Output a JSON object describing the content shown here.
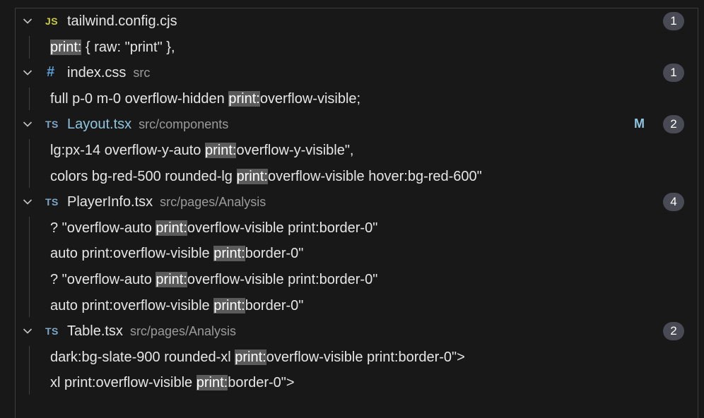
{
  "files": [
    {
      "name": "tailwind.config.cjs",
      "path": "",
      "icon": "js-file-icon",
      "icon_text": "JS",
      "count": "1",
      "modified": "",
      "matches": [
        {
          "before": "",
          "hit": "print:",
          "after": " { raw: \"print\" },"
        }
      ]
    },
    {
      "name": "index.css",
      "path": "src",
      "icon": "css-file-icon",
      "icon_text": "#",
      "count": "1",
      "modified": "",
      "matches": [
        {
          "before": "full p-0 m-0 overflow-hidden ",
          "hit": "print:",
          "after": "overflow-visible;"
        }
      ]
    },
    {
      "name": "Layout.tsx",
      "path": "src/components",
      "icon": "ts-file-icon",
      "icon_text": "TS",
      "count": "2",
      "modified": "M",
      "matches": [
        {
          "before": "lg:px-14 overflow-y-auto ",
          "hit": "print:",
          "after": "overflow-y-visible\","
        },
        {
          "before": "colors bg-red-500 rounded-lg ",
          "hit": "print:",
          "after": "overflow-visible hover:bg-red-600\""
        }
      ]
    },
    {
      "name": "PlayerInfo.tsx",
      "path": "src/pages/Analysis",
      "icon": "ts-file-icon",
      "icon_text": "TS",
      "count": "4",
      "modified": "",
      "matches": [
        {
          "before": "? \"overflow-auto ",
          "hit": "print:",
          "after": "overflow-visible print:border-0\""
        },
        {
          "before": "auto print:overflow-visible ",
          "hit": "print:",
          "after": "border-0\""
        },
        {
          "before": "? \"overflow-auto ",
          "hit": "print:",
          "after": "overflow-visible print:border-0\""
        },
        {
          "before": "auto print:overflow-visible ",
          "hit": "print:",
          "after": "border-0\""
        }
      ]
    },
    {
      "name": "Table.tsx",
      "path": "src/pages/Analysis",
      "icon": "ts-file-icon",
      "icon_text": "TS",
      "count": "2",
      "modified": "",
      "matches": [
        {
          "before": "dark:bg-slate-900 rounded-xl ",
          "hit": "print:",
          "after": "overflow-visible print:border-0\">"
        },
        {
          "before": "xl print:overflow-visible ",
          "hit": "print:",
          "after": "border-0\">"
        }
      ]
    }
  ]
}
